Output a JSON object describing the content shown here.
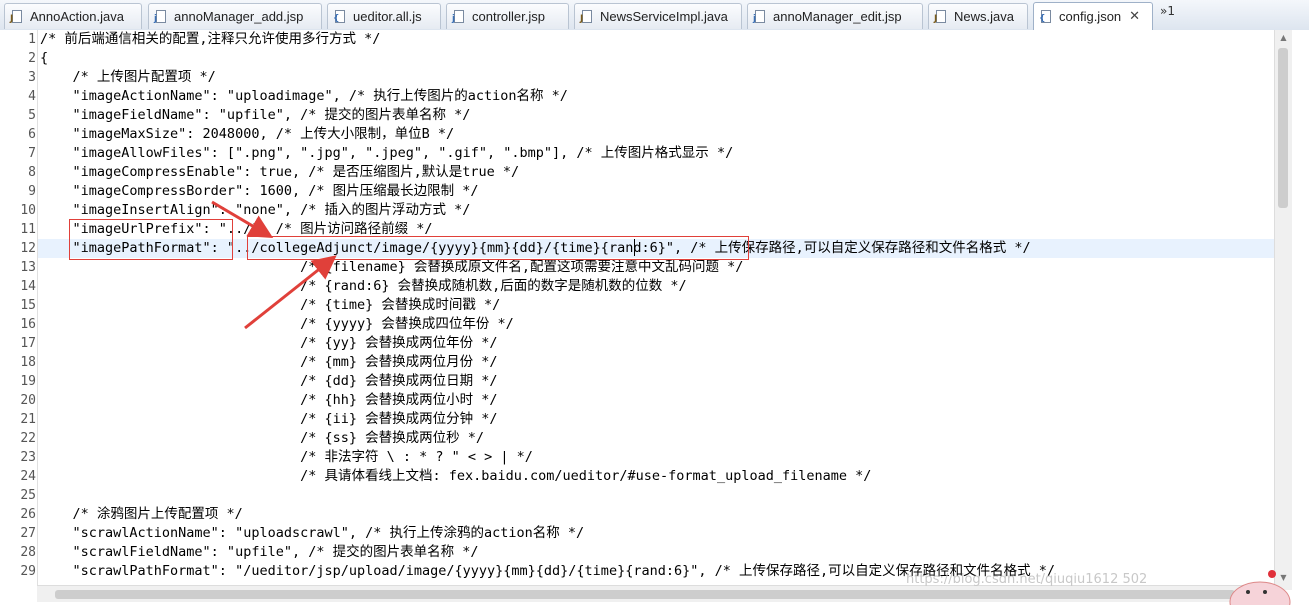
{
  "tabs": [
    {
      "label": "AnnoAction.java",
      "icon": "java-file-icon"
    },
    {
      "label": "annoManager_add.jsp",
      "icon": "jsp-file-icon"
    },
    {
      "label": "ueditor.all.js",
      "icon": "js-file-icon"
    },
    {
      "label": "controller.jsp",
      "icon": "jsp-file-icon"
    },
    {
      "label": "NewsServiceImpl.java",
      "icon": "java-file-icon"
    },
    {
      "label": "annoManager_edit.jsp",
      "icon": "jsp-file-icon"
    },
    {
      "label": "News.java",
      "icon": "java-file-icon"
    },
    {
      "label": "config.json",
      "icon": "json-file-icon",
      "active": true
    }
  ],
  "overflow_label": "»1",
  "close_glyph": "✕",
  "lines": [
    {
      "n": "1",
      "text": "/* 前后端通信相关的配置,注释只允许使用多行方式 */"
    },
    {
      "n": "2",
      "text": "{"
    },
    {
      "n": "3",
      "text": "    /* 上传图片配置项 */"
    },
    {
      "n": "4",
      "text": "    \"imageActionName\": \"uploadimage\", /* 执行上传图片的action名称 */"
    },
    {
      "n": "5",
      "text": "    \"imageFieldName\": \"upfile\", /* 提交的图片表单名称 */"
    },
    {
      "n": "6",
      "text": "    \"imageMaxSize\": 2048000, /* 上传大小限制，单位B */"
    },
    {
      "n": "7",
      "text": "    \"imageAllowFiles\": [\".png\", \".jpg\", \".jpeg\", \".gif\", \".bmp\"], /* 上传图片格式显示 */"
    },
    {
      "n": "8",
      "text": "    \"imageCompressEnable\": true, /* 是否压缩图片,默认是true */"
    },
    {
      "n": "9",
      "text": "    \"imageCompressBorder\": 1600, /* 图片压缩最长边限制 */"
    },
    {
      "n": "10",
      "text": "    \"imageInsertAlign\": \"none\", /* 插入的图片浮动方式 */"
    },
    {
      "n": "11",
      "text": "    \"imageUrlPrefix\": \"../\", /* 图片访问路径前缀 */"
    },
    {
      "n": "12",
      "text": "    \"imagePathFormat\": \"../collegeAdjunct/image/{yyyy}{mm}{dd}/{time}{rand:6}\", /* 上传保存路径,可以自定义保存路径和文件名格式 */"
    },
    {
      "n": "13",
      "text": "                                /* {filename} 会替换成原文件名,配置这项需要注意中文乱码问题 */"
    },
    {
      "n": "14",
      "text": "                                /* {rand:6} 会替换成随机数,后面的数字是随机数的位数 */"
    },
    {
      "n": "15",
      "text": "                                /* {time} 会替换成时间戳 */"
    },
    {
      "n": "16",
      "text": "                                /* {yyyy} 会替换成四位年份 */"
    },
    {
      "n": "17",
      "text": "                                /* {yy} 会替换成两位年份 */"
    },
    {
      "n": "18",
      "text": "                                /* {mm} 会替换成两位月份 */"
    },
    {
      "n": "19",
      "text": "                                /* {dd} 会替换成两位日期 */"
    },
    {
      "n": "20",
      "text": "                                /* {hh} 会替换成两位小时 */"
    },
    {
      "n": "21",
      "text": "                                /* {ii} 会替换成两位分钟 */"
    },
    {
      "n": "22",
      "text": "                                /* {ss} 会替换成两位秒 */"
    },
    {
      "n": "23",
      "text": "                                /* 非法字符 \\ : * ? \" < > | */"
    },
    {
      "n": "24",
      "text": "                                /* 具请体看线上文档: fex.baidu.com/ueditor/#use-format_upload_filename */"
    },
    {
      "n": "25",
      "text": ""
    },
    {
      "n": "26",
      "text": "    /* 涂鸦图片上传配置项 */"
    },
    {
      "n": "27",
      "text": "    \"scrawlActionName\": \"uploadscrawl\", /* 执行上传涂鸦的action名称 */"
    },
    {
      "n": "28",
      "text": "    \"scrawlFieldName\": \"upfile\", /* 提交的图片表单名称 */"
    },
    {
      "n": "29",
      "text": "    \"scrawlPathFormat\": \"/ueditor/jsp/upload/image/{yyyy}{mm}{dd}/{time}{rand:6}\", /* 上传保存路径,可以自定义保存路径和文件名格式 */"
    }
  ],
  "current_line": "12",
  "watermark": "https://blog.csdn.net/qiuqiu1612  502",
  "colors": {
    "annotation": "#e0403a",
    "current_line": "#e8f2fe"
  }
}
